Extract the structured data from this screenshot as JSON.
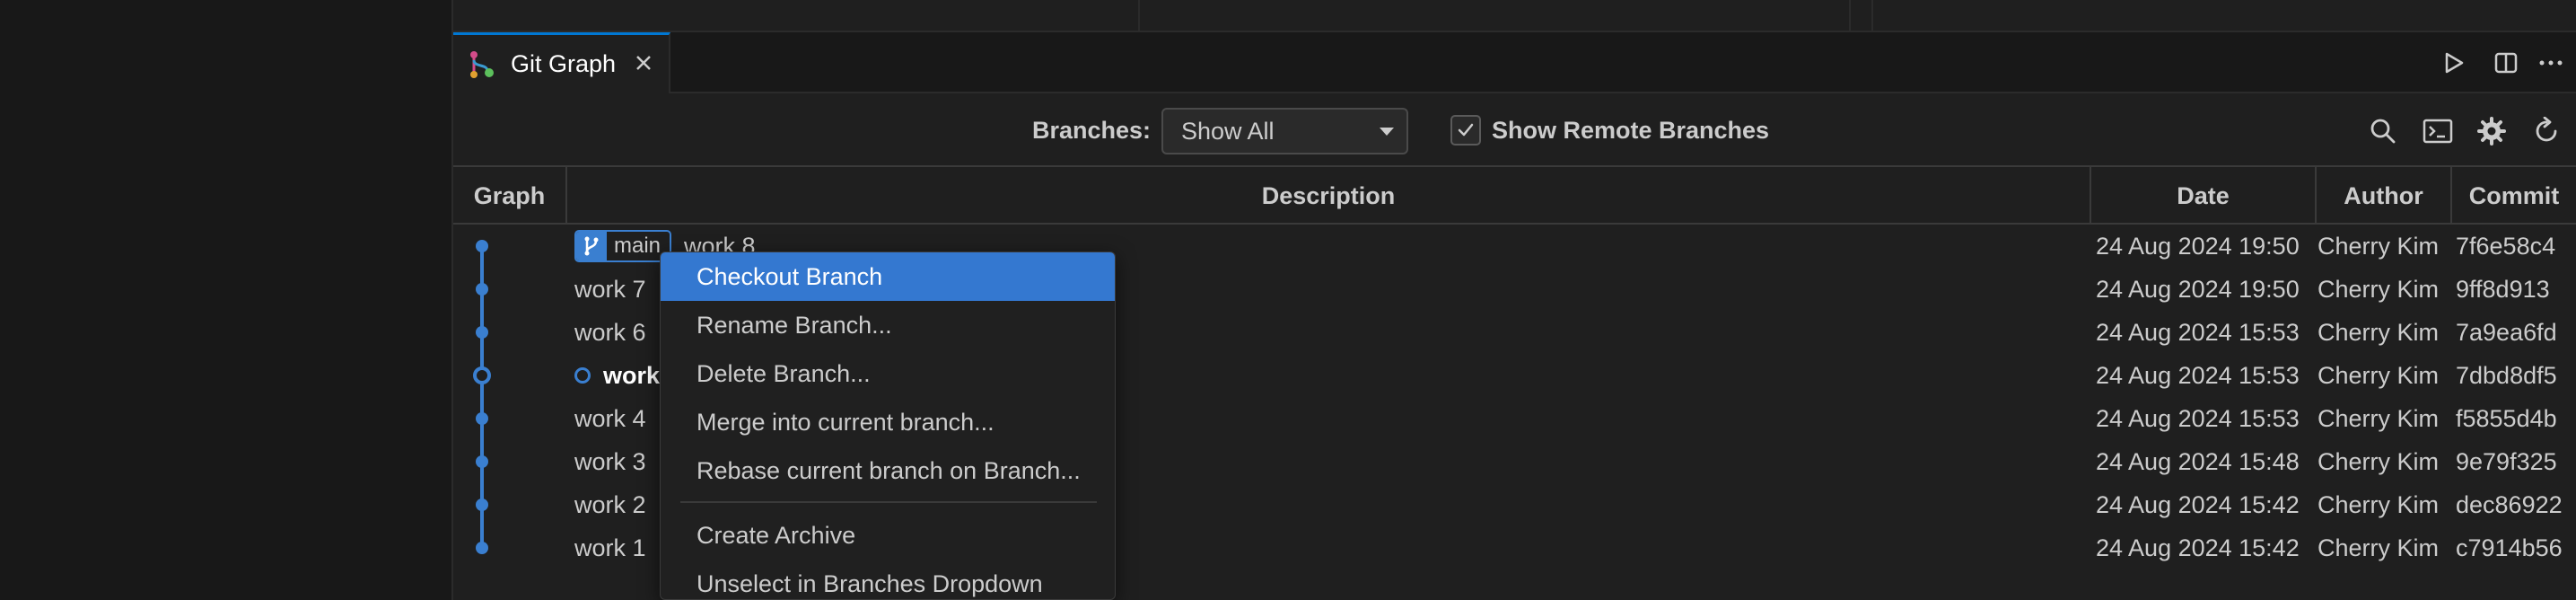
{
  "tab": {
    "title": "Git Graph"
  },
  "tab_actions": [
    "run-icon",
    "split-editor-icon",
    "more-actions-icon"
  ],
  "controls": {
    "branches_label": "Branches:",
    "branches_value": "Show All",
    "show_remote_label": "Show Remote Branches",
    "show_remote_checked": true,
    "icons": [
      "search-icon",
      "terminal-icon",
      "gear-icon",
      "refresh-icon"
    ]
  },
  "table": {
    "headers": {
      "graph": "Graph",
      "description": "Description",
      "date": "Date",
      "author": "Author",
      "commit": "Commit"
    },
    "rows": [
      {
        "description": "work 8",
        "date": "24 Aug 2024 19:50",
        "author": "Cherry Kim",
        "commit": "7f6e58c4",
        "branch": "main"
      },
      {
        "description": "work 7",
        "date": "24 Aug 2024 19:50",
        "author": "Cherry Kim",
        "commit": "9ff8d913"
      },
      {
        "description": "work 6",
        "date": "24 Aug 2024 15:53",
        "author": "Cherry Kim",
        "commit": "7a9ea6fd"
      },
      {
        "description": "work 5",
        "date": "24 Aug 2024 15:53",
        "author": "Cherry Kim",
        "commit": "7dbd8df5",
        "head": true
      },
      {
        "description": "work 4",
        "date": "24 Aug 2024 15:53",
        "author": "Cherry Kim",
        "commit": "f5855d4b"
      },
      {
        "description": "work 3",
        "date": "24 Aug 2024 15:48",
        "author": "Cherry Kim",
        "commit": "9e79f325"
      },
      {
        "description": "work 2",
        "date": "24 Aug 2024 15:42",
        "author": "Cherry Kim",
        "commit": "dec86922"
      },
      {
        "description": "work 1",
        "date": "24 Aug 2024 15:42",
        "author": "Cherry Kim",
        "commit": "c7914b56"
      }
    ]
  },
  "context_menu": {
    "items": [
      "Checkout Branch",
      "Rename Branch...",
      "Delete Branch...",
      "Merge into current branch...",
      "Rebase current branch on Branch...",
      "Create Archive",
      "Unselect in Branches Dropdown"
    ],
    "active_index": 0
  },
  "colors": {
    "accent": "#3a7fd0",
    "menu_highlight": "#3478d0",
    "tab_border": "#0078d4"
  }
}
